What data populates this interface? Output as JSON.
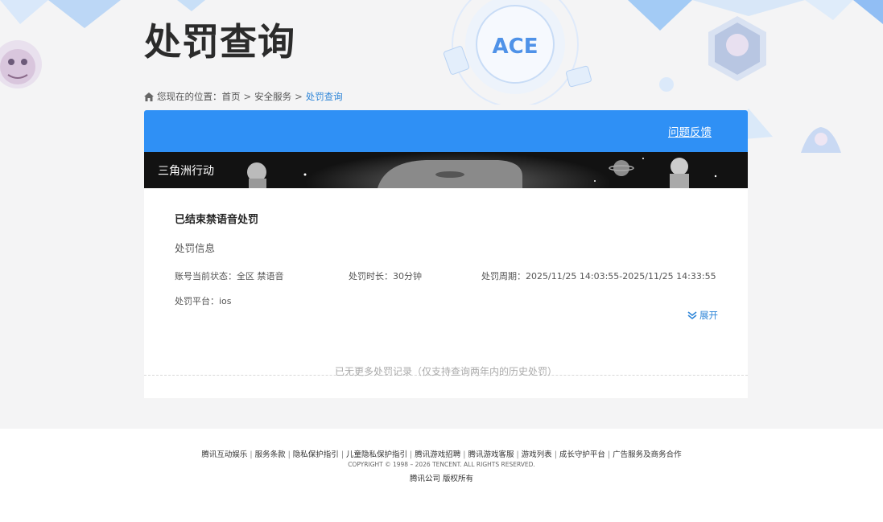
{
  "header": {
    "title": "处罚查询",
    "logo_text": "ACE"
  },
  "breadcrumb": {
    "prefix": "您现在的位置：",
    "items": [
      "首页",
      "安全服务",
      "处罚查询"
    ],
    "separator": ">"
  },
  "card": {
    "feedback_link": "问题反馈",
    "game_name": "三角洲行动",
    "record": {
      "title": "已结束禁语音处罚",
      "section_label": "处罚信息",
      "status": {
        "label": "账号当前状态：",
        "value": "全区 禁语音"
      },
      "duration": {
        "label": "处罚时长：",
        "value": "30分钟"
      },
      "period": {
        "label": "处罚周期：",
        "value": "2025/11/25 14:03:55-2025/11/25 14:33:55"
      },
      "platform": {
        "label": "处罚平台：",
        "value": "ios"
      },
      "expand_label": "展开"
    },
    "no_more_text": "已无更多处罚记录（仅支持查询两年内的历史处罚）"
  },
  "footer": {
    "links": [
      "腾讯互动娱乐",
      "服务条款",
      "隐私保护指引",
      "儿童隐私保护指引",
      "腾讯游戏招聘",
      "腾讯游戏客服",
      "游戏列表",
      "成长守护平台",
      "广告服务及商务合作"
    ],
    "link_separator": "|",
    "copyright": "COPYRIGHT © 1998 – 2026 TENCENT. ALL RIGHTS RESERVED.",
    "rights": "腾讯公司 版权所有"
  },
  "colors": {
    "accent": "#2f90f5",
    "link": "#2f86d8",
    "background": "#f4f4f5",
    "banner": "#121212"
  }
}
